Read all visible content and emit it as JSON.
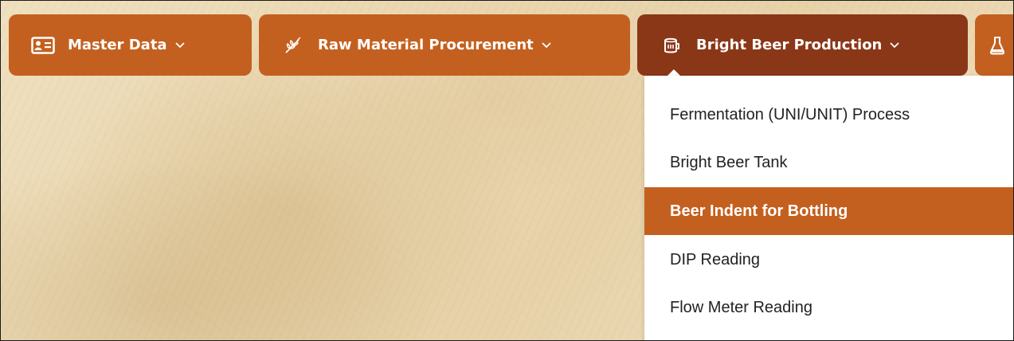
{
  "colors": {
    "nav_button": "#c4601f",
    "nav_button_active": "#8a3718",
    "menu_item_active": "#c4601f",
    "menu_text": "#222222",
    "background": "#ead7b1"
  },
  "navbar": {
    "items": [
      {
        "label": "Master Data",
        "icon": "id-card-icon",
        "has_dropdown": true
      },
      {
        "label": "Raw Material Procurement",
        "icon": "wheat-icon",
        "has_dropdown": true
      },
      {
        "label": "Bright Beer Production",
        "icon": "beer-tank-icon",
        "has_dropdown": true,
        "active": true
      },
      {
        "label": "",
        "icon": "flask-icon",
        "has_dropdown": true
      }
    ]
  },
  "dropdown": {
    "items": [
      {
        "label": "Fermentation (UNI/UNIT) Process"
      },
      {
        "label": "Bright Beer Tank"
      },
      {
        "label": "Beer Indent for Bottling",
        "selected": true
      },
      {
        "label": "DIP Reading"
      },
      {
        "label": "Flow Meter Reading"
      }
    ]
  }
}
